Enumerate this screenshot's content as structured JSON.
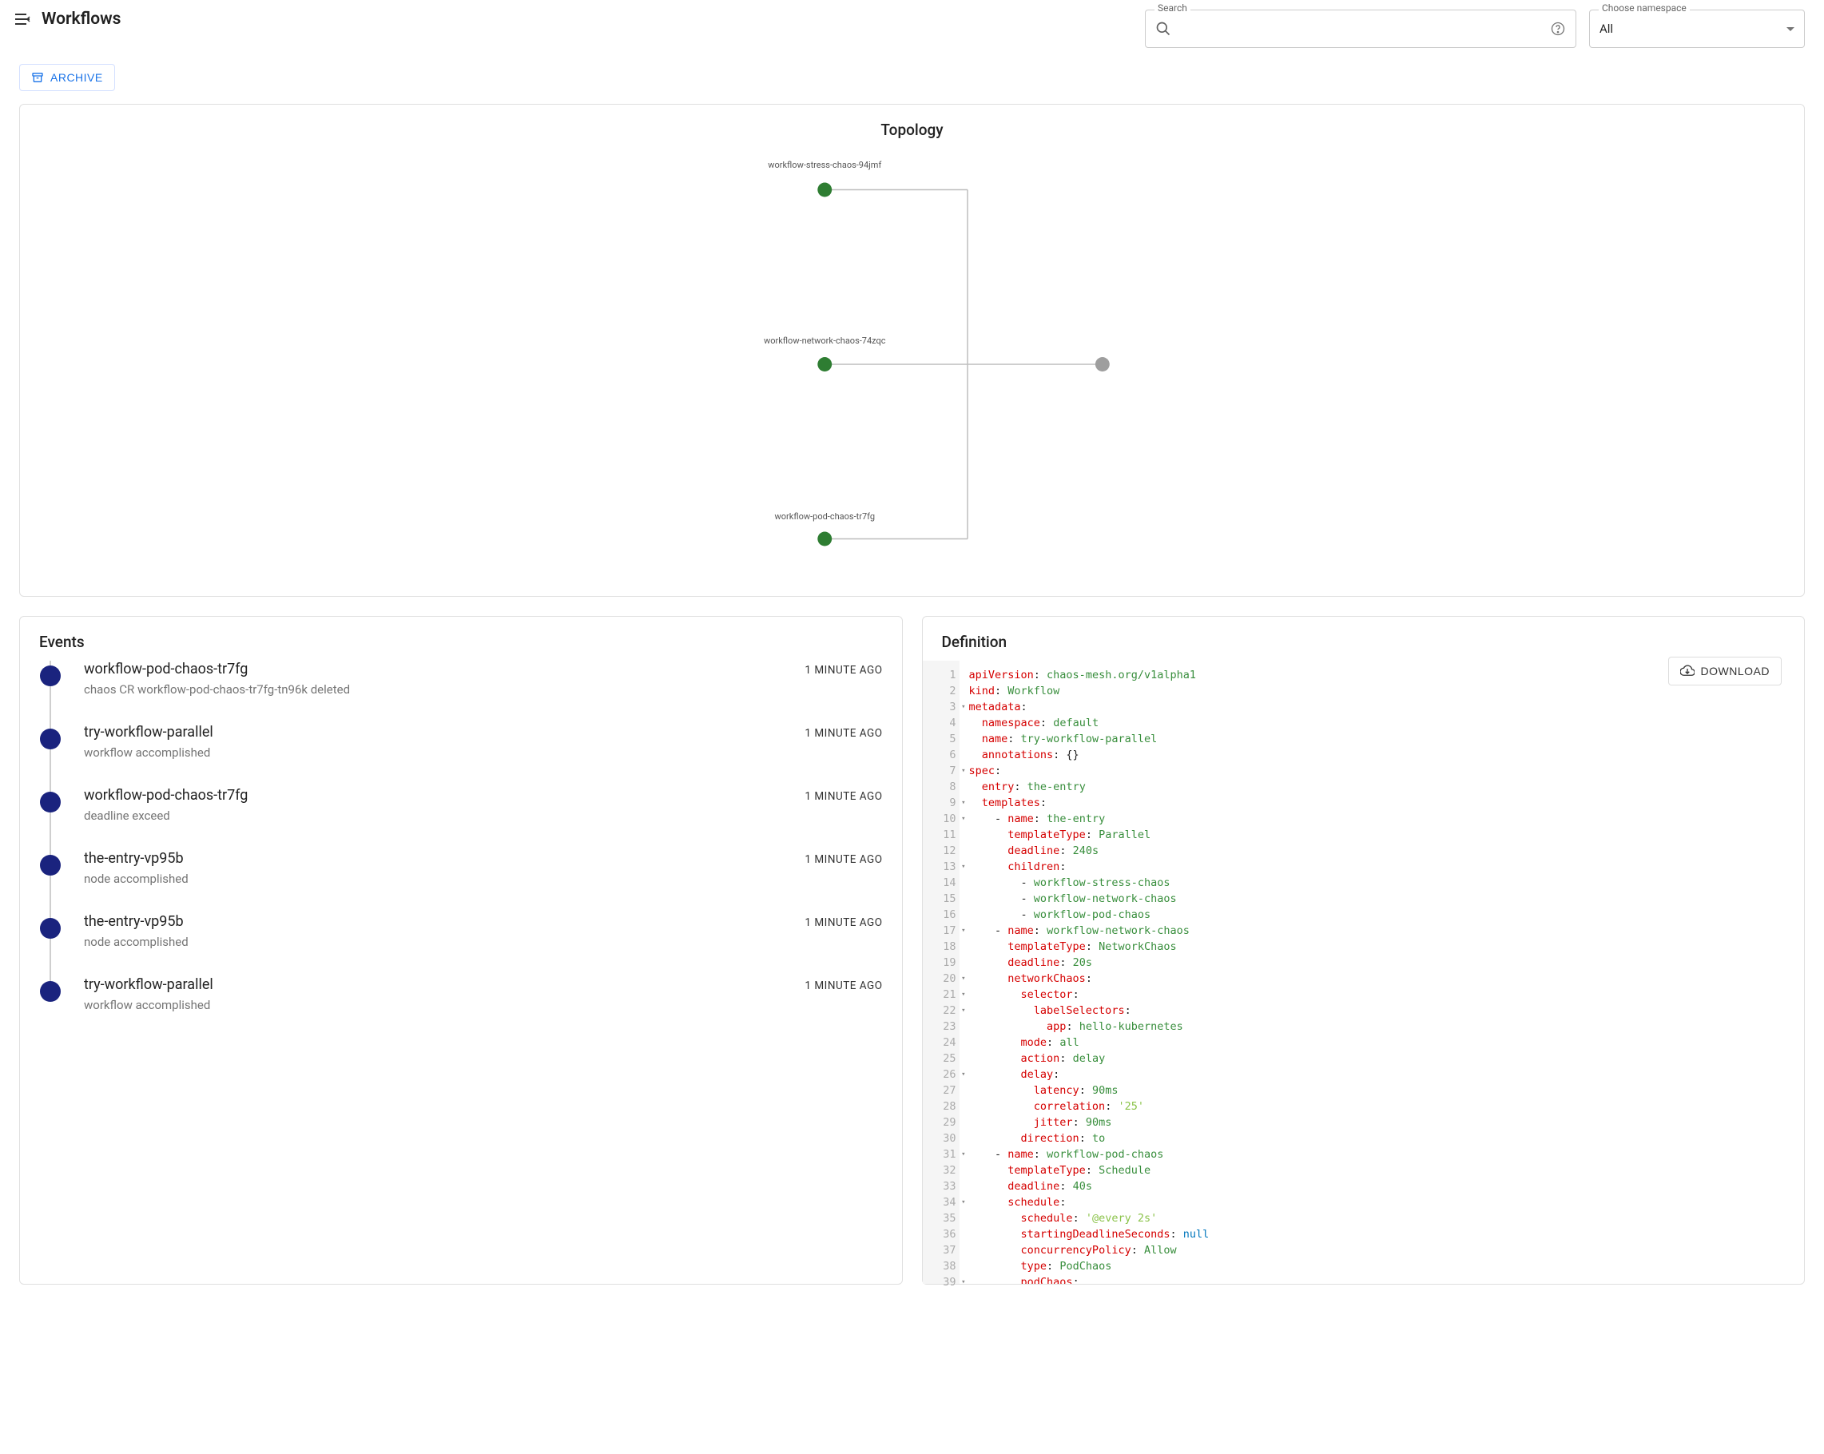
{
  "header": {
    "title": "Workflows",
    "search_label": "Search",
    "search_placeholder": "",
    "namespace_label": "Choose namespace",
    "namespace_value": "All"
  },
  "toolbar": {
    "archive_label": "ARCHIVE"
  },
  "topology": {
    "title": "Topology",
    "nodes": [
      {
        "id": "n1",
        "label": "workflow-stress-chaos-94jmf",
        "color": "#2e7d32"
      },
      {
        "id": "n2",
        "label": "workflow-network-chaos-74zqc",
        "color": "#2e7d32"
      },
      {
        "id": "n3",
        "label": "workflow-pod-chaos-tr7fg",
        "color": "#2e7d32"
      },
      {
        "id": "root",
        "label": "",
        "color": "#9e9e9e"
      }
    ]
  },
  "events": {
    "title": "Events",
    "items": [
      {
        "title": "workflow-pod-chaos-tr7fg",
        "desc": "chaos CR workflow-pod-chaos-tr7fg-tn96k deleted",
        "time": "1 MINUTE AGO"
      },
      {
        "title": "try-workflow-parallel",
        "desc": "workflow accomplished",
        "time": "1 MINUTE AGO"
      },
      {
        "title": "workflow-pod-chaos-tr7fg",
        "desc": "deadline exceed",
        "time": "1 MINUTE AGO"
      },
      {
        "title": "the-entry-vp95b",
        "desc": "node accomplished",
        "time": "1 MINUTE AGO"
      },
      {
        "title": "the-entry-vp95b",
        "desc": "node accomplished",
        "time": "1 MINUTE AGO"
      },
      {
        "title": "try-workflow-parallel",
        "desc": "workflow accomplished",
        "time": "1 MINUTE AGO"
      }
    ]
  },
  "definition": {
    "title": "Definition",
    "download_label": "DOWNLOAD",
    "lines": [
      {
        "n": 1,
        "fold": false,
        "parts": [
          {
            "t": "key",
            "v": "apiVersion"
          },
          {
            "t": "p",
            "v": ": "
          },
          {
            "t": "val",
            "v": "chaos-mesh.org/v1alpha1"
          }
        ]
      },
      {
        "n": 2,
        "fold": false,
        "parts": [
          {
            "t": "key",
            "v": "kind"
          },
          {
            "t": "p",
            "v": ": "
          },
          {
            "t": "val",
            "v": "Workflow"
          }
        ]
      },
      {
        "n": 3,
        "fold": true,
        "parts": [
          {
            "t": "key",
            "v": "metadata"
          },
          {
            "t": "p",
            "v": ":"
          }
        ]
      },
      {
        "n": 4,
        "fold": false,
        "parts": [
          {
            "t": "p",
            "v": "  "
          },
          {
            "t": "key",
            "v": "namespace"
          },
          {
            "t": "p",
            "v": ": "
          },
          {
            "t": "val",
            "v": "default"
          }
        ]
      },
      {
        "n": 5,
        "fold": false,
        "parts": [
          {
            "t": "p",
            "v": "  "
          },
          {
            "t": "key",
            "v": "name"
          },
          {
            "t": "p",
            "v": ": "
          },
          {
            "t": "val",
            "v": "try-workflow-parallel"
          }
        ]
      },
      {
        "n": 6,
        "fold": false,
        "parts": [
          {
            "t": "p",
            "v": "  "
          },
          {
            "t": "key",
            "v": "annotations"
          },
          {
            "t": "p",
            "v": ": {}"
          }
        ]
      },
      {
        "n": 7,
        "fold": true,
        "parts": [
          {
            "t": "key",
            "v": "spec"
          },
          {
            "t": "p",
            "v": ":"
          }
        ]
      },
      {
        "n": 8,
        "fold": false,
        "parts": [
          {
            "t": "p",
            "v": "  "
          },
          {
            "t": "key",
            "v": "entry"
          },
          {
            "t": "p",
            "v": ": "
          },
          {
            "t": "val",
            "v": "the-entry"
          }
        ]
      },
      {
        "n": 9,
        "fold": true,
        "parts": [
          {
            "t": "p",
            "v": "  "
          },
          {
            "t": "key",
            "v": "templates"
          },
          {
            "t": "p",
            "v": ":"
          }
        ]
      },
      {
        "n": 10,
        "fold": true,
        "parts": [
          {
            "t": "p",
            "v": "    - "
          },
          {
            "t": "key",
            "v": "name"
          },
          {
            "t": "p",
            "v": ": "
          },
          {
            "t": "val",
            "v": "the-entry"
          }
        ]
      },
      {
        "n": 11,
        "fold": false,
        "parts": [
          {
            "t": "p",
            "v": "      "
          },
          {
            "t": "key",
            "v": "templateType"
          },
          {
            "t": "p",
            "v": ": "
          },
          {
            "t": "val",
            "v": "Parallel"
          }
        ]
      },
      {
        "n": 12,
        "fold": false,
        "parts": [
          {
            "t": "p",
            "v": "      "
          },
          {
            "t": "key",
            "v": "deadline"
          },
          {
            "t": "p",
            "v": ": "
          },
          {
            "t": "val",
            "v": "240s"
          }
        ]
      },
      {
        "n": 13,
        "fold": true,
        "parts": [
          {
            "t": "p",
            "v": "      "
          },
          {
            "t": "key",
            "v": "children"
          },
          {
            "t": "p",
            "v": ":"
          }
        ]
      },
      {
        "n": 14,
        "fold": false,
        "parts": [
          {
            "t": "p",
            "v": "        - "
          },
          {
            "t": "val",
            "v": "workflow-stress-chaos"
          }
        ]
      },
      {
        "n": 15,
        "fold": false,
        "parts": [
          {
            "t": "p",
            "v": "        - "
          },
          {
            "t": "val",
            "v": "workflow-network-chaos"
          }
        ]
      },
      {
        "n": 16,
        "fold": false,
        "parts": [
          {
            "t": "p",
            "v": "        - "
          },
          {
            "t": "val",
            "v": "workflow-pod-chaos"
          }
        ]
      },
      {
        "n": 17,
        "fold": true,
        "parts": [
          {
            "t": "p",
            "v": "    - "
          },
          {
            "t": "key",
            "v": "name"
          },
          {
            "t": "p",
            "v": ": "
          },
          {
            "t": "val",
            "v": "workflow-network-chaos"
          }
        ]
      },
      {
        "n": 18,
        "fold": false,
        "parts": [
          {
            "t": "p",
            "v": "      "
          },
          {
            "t": "key",
            "v": "templateType"
          },
          {
            "t": "p",
            "v": ": "
          },
          {
            "t": "val",
            "v": "NetworkChaos"
          }
        ]
      },
      {
        "n": 19,
        "fold": false,
        "parts": [
          {
            "t": "p",
            "v": "      "
          },
          {
            "t": "key",
            "v": "deadline"
          },
          {
            "t": "p",
            "v": ": "
          },
          {
            "t": "val",
            "v": "20s"
          }
        ]
      },
      {
        "n": 20,
        "fold": true,
        "parts": [
          {
            "t": "p",
            "v": "      "
          },
          {
            "t": "key",
            "v": "networkChaos"
          },
          {
            "t": "p",
            "v": ":"
          }
        ]
      },
      {
        "n": 21,
        "fold": true,
        "parts": [
          {
            "t": "p",
            "v": "        "
          },
          {
            "t": "key",
            "v": "selector"
          },
          {
            "t": "p",
            "v": ":"
          }
        ]
      },
      {
        "n": 22,
        "fold": true,
        "parts": [
          {
            "t": "p",
            "v": "          "
          },
          {
            "t": "key",
            "v": "labelSelectors"
          },
          {
            "t": "p",
            "v": ":"
          }
        ]
      },
      {
        "n": 23,
        "fold": false,
        "parts": [
          {
            "t": "p",
            "v": "            "
          },
          {
            "t": "key",
            "v": "app"
          },
          {
            "t": "p",
            "v": ": "
          },
          {
            "t": "val",
            "v": "hello-kubernetes"
          }
        ]
      },
      {
        "n": 24,
        "fold": false,
        "parts": [
          {
            "t": "p",
            "v": "        "
          },
          {
            "t": "key",
            "v": "mode"
          },
          {
            "t": "p",
            "v": ": "
          },
          {
            "t": "val",
            "v": "all"
          }
        ]
      },
      {
        "n": 25,
        "fold": false,
        "parts": [
          {
            "t": "p",
            "v": "        "
          },
          {
            "t": "key",
            "v": "action"
          },
          {
            "t": "p",
            "v": ": "
          },
          {
            "t": "val",
            "v": "delay"
          }
        ]
      },
      {
        "n": 26,
        "fold": true,
        "parts": [
          {
            "t": "p",
            "v": "        "
          },
          {
            "t": "key",
            "v": "delay"
          },
          {
            "t": "p",
            "v": ":"
          }
        ]
      },
      {
        "n": 27,
        "fold": false,
        "parts": [
          {
            "t": "p",
            "v": "          "
          },
          {
            "t": "key",
            "v": "latency"
          },
          {
            "t": "p",
            "v": ": "
          },
          {
            "t": "val",
            "v": "90ms"
          }
        ]
      },
      {
        "n": 28,
        "fold": false,
        "parts": [
          {
            "t": "p",
            "v": "          "
          },
          {
            "t": "key",
            "v": "correlation"
          },
          {
            "t": "p",
            "v": ": "
          },
          {
            "t": "str",
            "v": "'25'"
          }
        ]
      },
      {
        "n": 29,
        "fold": false,
        "parts": [
          {
            "t": "p",
            "v": "          "
          },
          {
            "t": "key",
            "v": "jitter"
          },
          {
            "t": "p",
            "v": ": "
          },
          {
            "t": "val",
            "v": "90ms"
          }
        ]
      },
      {
        "n": 30,
        "fold": false,
        "parts": [
          {
            "t": "p",
            "v": "        "
          },
          {
            "t": "key",
            "v": "direction"
          },
          {
            "t": "p",
            "v": ": "
          },
          {
            "t": "val",
            "v": "to"
          }
        ]
      },
      {
        "n": 31,
        "fold": true,
        "parts": [
          {
            "t": "p",
            "v": "    - "
          },
          {
            "t": "key",
            "v": "name"
          },
          {
            "t": "p",
            "v": ": "
          },
          {
            "t": "val",
            "v": "workflow-pod-chaos"
          }
        ]
      },
      {
        "n": 32,
        "fold": false,
        "parts": [
          {
            "t": "p",
            "v": "      "
          },
          {
            "t": "key",
            "v": "templateType"
          },
          {
            "t": "p",
            "v": ": "
          },
          {
            "t": "val",
            "v": "Schedule"
          }
        ]
      },
      {
        "n": 33,
        "fold": false,
        "parts": [
          {
            "t": "p",
            "v": "      "
          },
          {
            "t": "key",
            "v": "deadline"
          },
          {
            "t": "p",
            "v": ": "
          },
          {
            "t": "val",
            "v": "40s"
          }
        ]
      },
      {
        "n": 34,
        "fold": true,
        "parts": [
          {
            "t": "p",
            "v": "      "
          },
          {
            "t": "key",
            "v": "schedule"
          },
          {
            "t": "p",
            "v": ":"
          }
        ]
      },
      {
        "n": 35,
        "fold": false,
        "parts": [
          {
            "t": "p",
            "v": "        "
          },
          {
            "t": "key",
            "v": "schedule"
          },
          {
            "t": "p",
            "v": ": "
          },
          {
            "t": "str",
            "v": "'@every 2s'"
          }
        ]
      },
      {
        "n": 36,
        "fold": false,
        "parts": [
          {
            "t": "p",
            "v": "        "
          },
          {
            "t": "key",
            "v": "startingDeadlineSeconds"
          },
          {
            "t": "p",
            "v": ": "
          },
          {
            "t": "null",
            "v": "null"
          }
        ]
      },
      {
        "n": 37,
        "fold": false,
        "parts": [
          {
            "t": "p",
            "v": "        "
          },
          {
            "t": "key",
            "v": "concurrencyPolicy"
          },
          {
            "t": "p",
            "v": ": "
          },
          {
            "t": "val",
            "v": "Allow"
          }
        ]
      },
      {
        "n": 38,
        "fold": false,
        "parts": [
          {
            "t": "p",
            "v": "        "
          },
          {
            "t": "key",
            "v": "type"
          },
          {
            "t": "p",
            "v": ": "
          },
          {
            "t": "val",
            "v": "PodChaos"
          }
        ]
      },
      {
        "n": 39,
        "fold": true,
        "parts": [
          {
            "t": "p",
            "v": "        "
          },
          {
            "t": "key",
            "v": "podChaos"
          },
          {
            "t": "p",
            "v": ":"
          }
        ]
      }
    ]
  }
}
